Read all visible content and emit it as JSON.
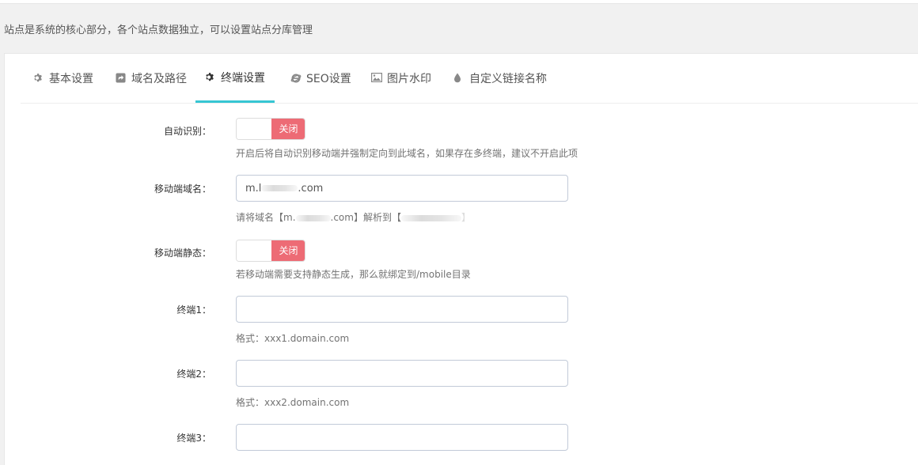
{
  "page": {
    "note": "站点是系统的核心部分，各个站点数据独立，可以设置站点分库管理"
  },
  "tabs": [
    {
      "label": "基本设置",
      "icon": "gear-icon",
      "active": false
    },
    {
      "label": "域名及路径",
      "icon": "share-square-icon",
      "active": false
    },
    {
      "label": "终端设置",
      "icon": "gear-icon",
      "active": true
    },
    {
      "label": "SEO设置",
      "icon": "internet-explorer-icon",
      "active": false
    },
    {
      "label": "图片水印",
      "icon": "picture-icon",
      "active": false
    },
    {
      "label": "自定义链接名称",
      "icon": "tint-icon",
      "active": false
    }
  ],
  "form": {
    "auto_detect": {
      "label": "自动识别：",
      "state_label": "关闭",
      "help": "开启后将自动识别移动端并强制定向到此域名，如果存在多终端，建议不开启此项"
    },
    "mobile_domain": {
      "label": "移动端域名：",
      "value_prefix": "m.l",
      "value_suffix": ".com",
      "help_prefix": "请将域名【m.",
      "help_middle": ".com】解析到【",
      "help_suffix": "】"
    },
    "mobile_static": {
      "label": "移动端静态：",
      "state_label": "关闭",
      "help": "若移动端需要支持静态生成，那么就绑定到/mobile目录"
    },
    "terminal1": {
      "label": "终端1：",
      "value": "",
      "help": "格式：xxx1.domain.com"
    },
    "terminal2": {
      "label": "终端2：",
      "value": "",
      "help": "格式：xxx2.domain.com"
    },
    "terminal3": {
      "label": "终端3：",
      "value": ""
    }
  },
  "colors": {
    "accent": "#36c6d3",
    "off_state": "#ed6b75",
    "input_border": "#c2cad8"
  }
}
